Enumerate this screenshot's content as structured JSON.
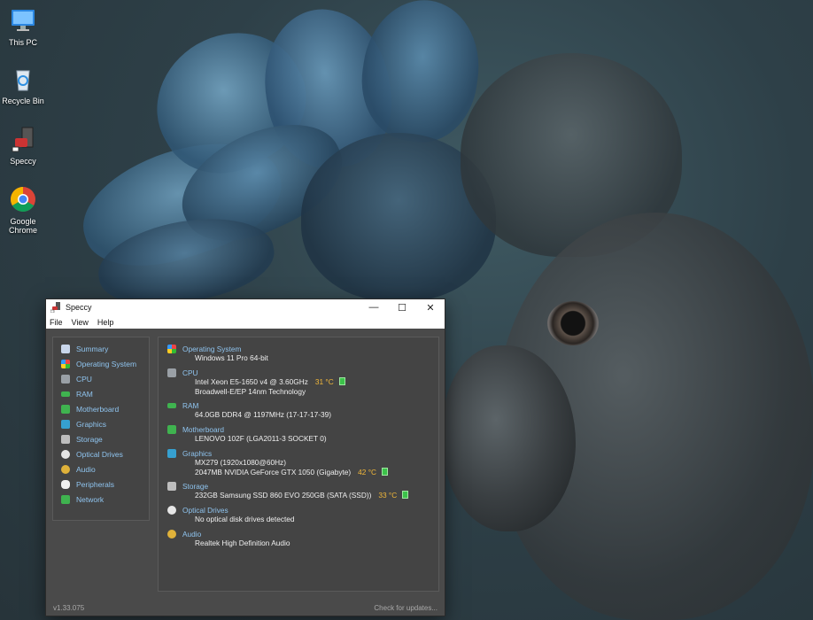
{
  "desktop": {
    "icons": [
      {
        "label": "This PC"
      },
      {
        "label": "Recycle Bin"
      },
      {
        "label": "Speccy"
      },
      {
        "label": "Google Chrome"
      }
    ]
  },
  "window": {
    "title": "Speccy",
    "controls": {
      "minimize": "—",
      "maximize": "☐",
      "close": "✕"
    },
    "menu": [
      "File",
      "View",
      "Help"
    ],
    "nav": [
      {
        "label": "Summary",
        "color": "#c9d6ea"
      },
      {
        "label": "Operating System",
        "color": "#3c8fe0"
      },
      {
        "label": "CPU",
        "color": "#9aa0a6"
      },
      {
        "label": "RAM",
        "color": "#3fb34f"
      },
      {
        "label": "Motherboard",
        "color": "#3fb34f"
      },
      {
        "label": "Graphics",
        "color": "#36a0d0"
      },
      {
        "label": "Storage",
        "color": "#bdbdbd"
      },
      {
        "label": "Optical Drives",
        "color": "#e6e6e6"
      },
      {
        "label": "Audio",
        "color": "#e0b23a"
      },
      {
        "label": "Peripherals",
        "color": "#f0f0f0"
      },
      {
        "label": "Network",
        "color": "#3fb34f"
      }
    ],
    "summary": {
      "os": {
        "title": "Operating System",
        "lines": [
          "Windows 11 Pro 64-bit"
        ]
      },
      "cpu": {
        "title": "CPU",
        "line1": "Intel Xeon E5-1650 v4 @ 3.60GHz",
        "temp": "31 °C",
        "line2": "Broadwell-E/EP 14nm Technology"
      },
      "ram": {
        "title": "RAM",
        "lines": [
          "64.0GB DDR4 @ 1197MHz (17-17-17-39)"
        ]
      },
      "motherboard": {
        "title": "Motherboard",
        "lines": [
          "LENOVO 102F (LGA2011-3 SOCKET 0)"
        ]
      },
      "graphics": {
        "title": "Graphics",
        "line1": "MX279 (1920x1080@60Hz)",
        "line2": "2047MB NVIDIA GeForce GTX 1050 (Gigabyte)",
        "temp": "42 °C"
      },
      "storage": {
        "title": "Storage",
        "line1": "232GB Samsung SSD 860 EVO 250GB (SATA (SSD))",
        "temp": "33 °C"
      },
      "optical": {
        "title": "Optical Drives",
        "lines": [
          "No optical disk drives detected"
        ]
      },
      "audio": {
        "title": "Audio",
        "lines": [
          "Realtek High Definition Audio"
        ]
      }
    },
    "status": {
      "version": "v1.33.075",
      "update_link": "Check for updates..."
    }
  }
}
